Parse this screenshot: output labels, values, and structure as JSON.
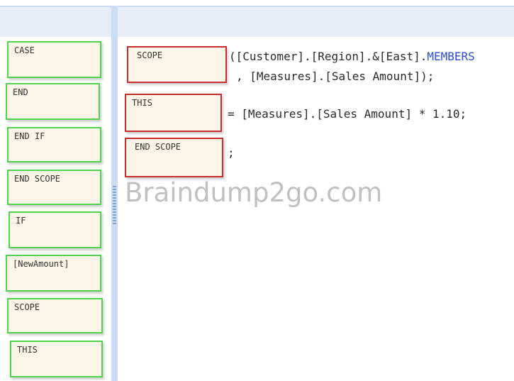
{
  "source_tiles": [
    {
      "label": "CASE"
    },
    {
      "label": "END"
    },
    {
      "label": "END IF"
    },
    {
      "label": "END SCOPE"
    },
    {
      "label": "IF"
    },
    {
      "label": "[NewAmount]"
    },
    {
      "label": "SCOPE"
    },
    {
      "label": "THIS"
    }
  ],
  "answer_area": {
    "slots": [
      {
        "label": "SCOPE"
      },
      {
        "label": "THIS"
      },
      {
        "label": "END SCOPE"
      }
    ],
    "code": {
      "line1_text": "([Customer].[Region].&[East].",
      "line1_keyword": "MEMBERS",
      "line2": ", [Measures].[Sales Amount]);",
      "line3": "= [Measures].[Sales Amount] * 1.10;",
      "line4": ";"
    }
  },
  "watermark": "Braindump2go.com",
  "colors": {
    "source_border": "#4fd34b",
    "answer_border": "#c62d2d",
    "tile_fill": "#fdf6e8",
    "keyword": "#2b4cd3"
  }
}
